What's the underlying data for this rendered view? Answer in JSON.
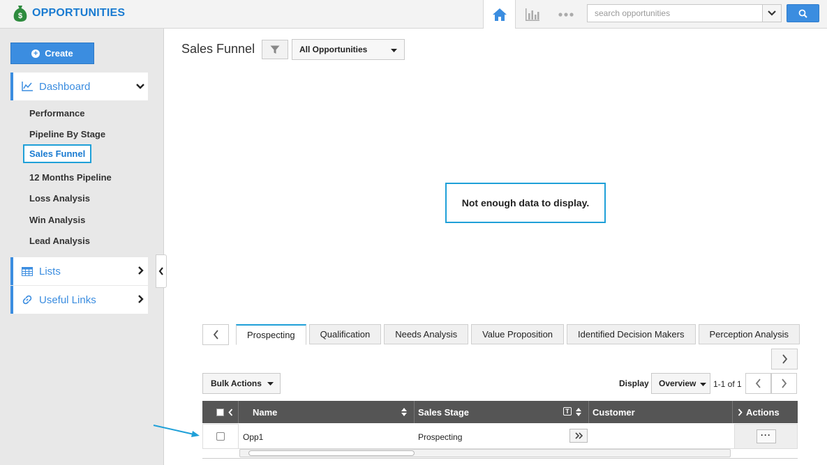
{
  "app": {
    "title": "OPPORTUNITIES",
    "brand_color": "#1a7bd1",
    "accent_color": "#3b8de0",
    "highlight_color": "#1fa0d8"
  },
  "topbar": {
    "search_placeholder": "search opportunities",
    "icons": [
      "home-icon",
      "bar-chart-icon",
      "more-dots-icon",
      "chevron-down-icon",
      "search-icon"
    ]
  },
  "sidebar": {
    "create_label": "Create",
    "dashboard_label": "Dashboard",
    "items": [
      {
        "label": "Performance"
      },
      {
        "label": "Pipeline By Stage"
      },
      {
        "label": "Sales Funnel"
      },
      {
        "label": "12 Months Pipeline"
      },
      {
        "label": "Loss Analysis"
      },
      {
        "label": "Win Analysis"
      },
      {
        "label": "Lead Analysis"
      }
    ],
    "active_item": "Sales Funnel",
    "lists_label": "Lists",
    "links_label": "Useful Links"
  },
  "main": {
    "title": "Sales Funnel",
    "view_select": "All Opportunities",
    "empty_message": "Not enough data to display."
  },
  "stages": {
    "tabs": [
      {
        "label": "Prospecting"
      },
      {
        "label": "Qualification"
      },
      {
        "label": "Needs Analysis"
      },
      {
        "label": "Value Proposition"
      },
      {
        "label": "Identified Decision Makers"
      },
      {
        "label": "Perception Analysis"
      }
    ],
    "active_tab": "Prospecting"
  },
  "toolbar": {
    "bulk_actions": "Bulk Actions",
    "display_label": "Display",
    "display_value": "Overview",
    "page_count": "1-1 of 1"
  },
  "table": {
    "columns": [
      "Name",
      "Sales Stage",
      "Customer",
      "Actions"
    ],
    "rows": [
      {
        "name": "Opp1",
        "sales_stage": "Prospecting",
        "customer": ""
      }
    ],
    "actions_button": "···"
  }
}
